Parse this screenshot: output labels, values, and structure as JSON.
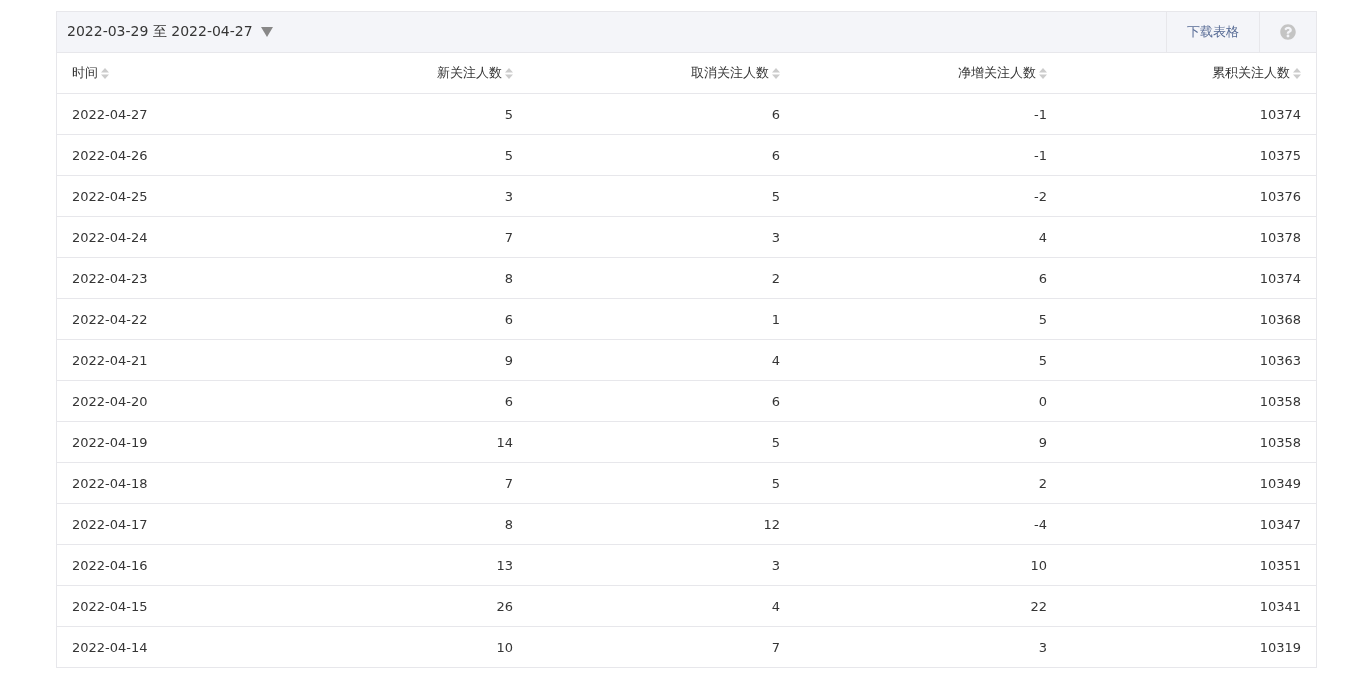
{
  "toolbar": {
    "date_range": "2022-03-29 至 2022-04-27",
    "download_button": "下载表格"
  },
  "table": {
    "columns": [
      "时间",
      "新关注人数",
      "取消关注人数",
      "净增关注人数",
      "累积关注人数"
    ],
    "rows": [
      [
        "2022-04-27",
        "5",
        "6",
        "-1",
        "10374"
      ],
      [
        "2022-04-26",
        "5",
        "6",
        "-1",
        "10375"
      ],
      [
        "2022-04-25",
        "3",
        "5",
        "-2",
        "10376"
      ],
      [
        "2022-04-24",
        "7",
        "3",
        "4",
        "10378"
      ],
      [
        "2022-04-23",
        "8",
        "2",
        "6",
        "10374"
      ],
      [
        "2022-04-22",
        "6",
        "1",
        "5",
        "10368"
      ],
      [
        "2022-04-21",
        "9",
        "4",
        "5",
        "10363"
      ],
      [
        "2022-04-20",
        "6",
        "6",
        "0",
        "10358"
      ],
      [
        "2022-04-19",
        "14",
        "5",
        "9",
        "10358"
      ],
      [
        "2022-04-18",
        "7",
        "5",
        "2",
        "10349"
      ],
      [
        "2022-04-17",
        "8",
        "12",
        "-4",
        "10347"
      ],
      [
        "2022-04-16",
        "13",
        "3",
        "10",
        "10351"
      ],
      [
        "2022-04-15",
        "26",
        "4",
        "22",
        "10341"
      ],
      [
        "2022-04-14",
        "10",
        "7",
        "3",
        "10319"
      ]
    ]
  }
}
